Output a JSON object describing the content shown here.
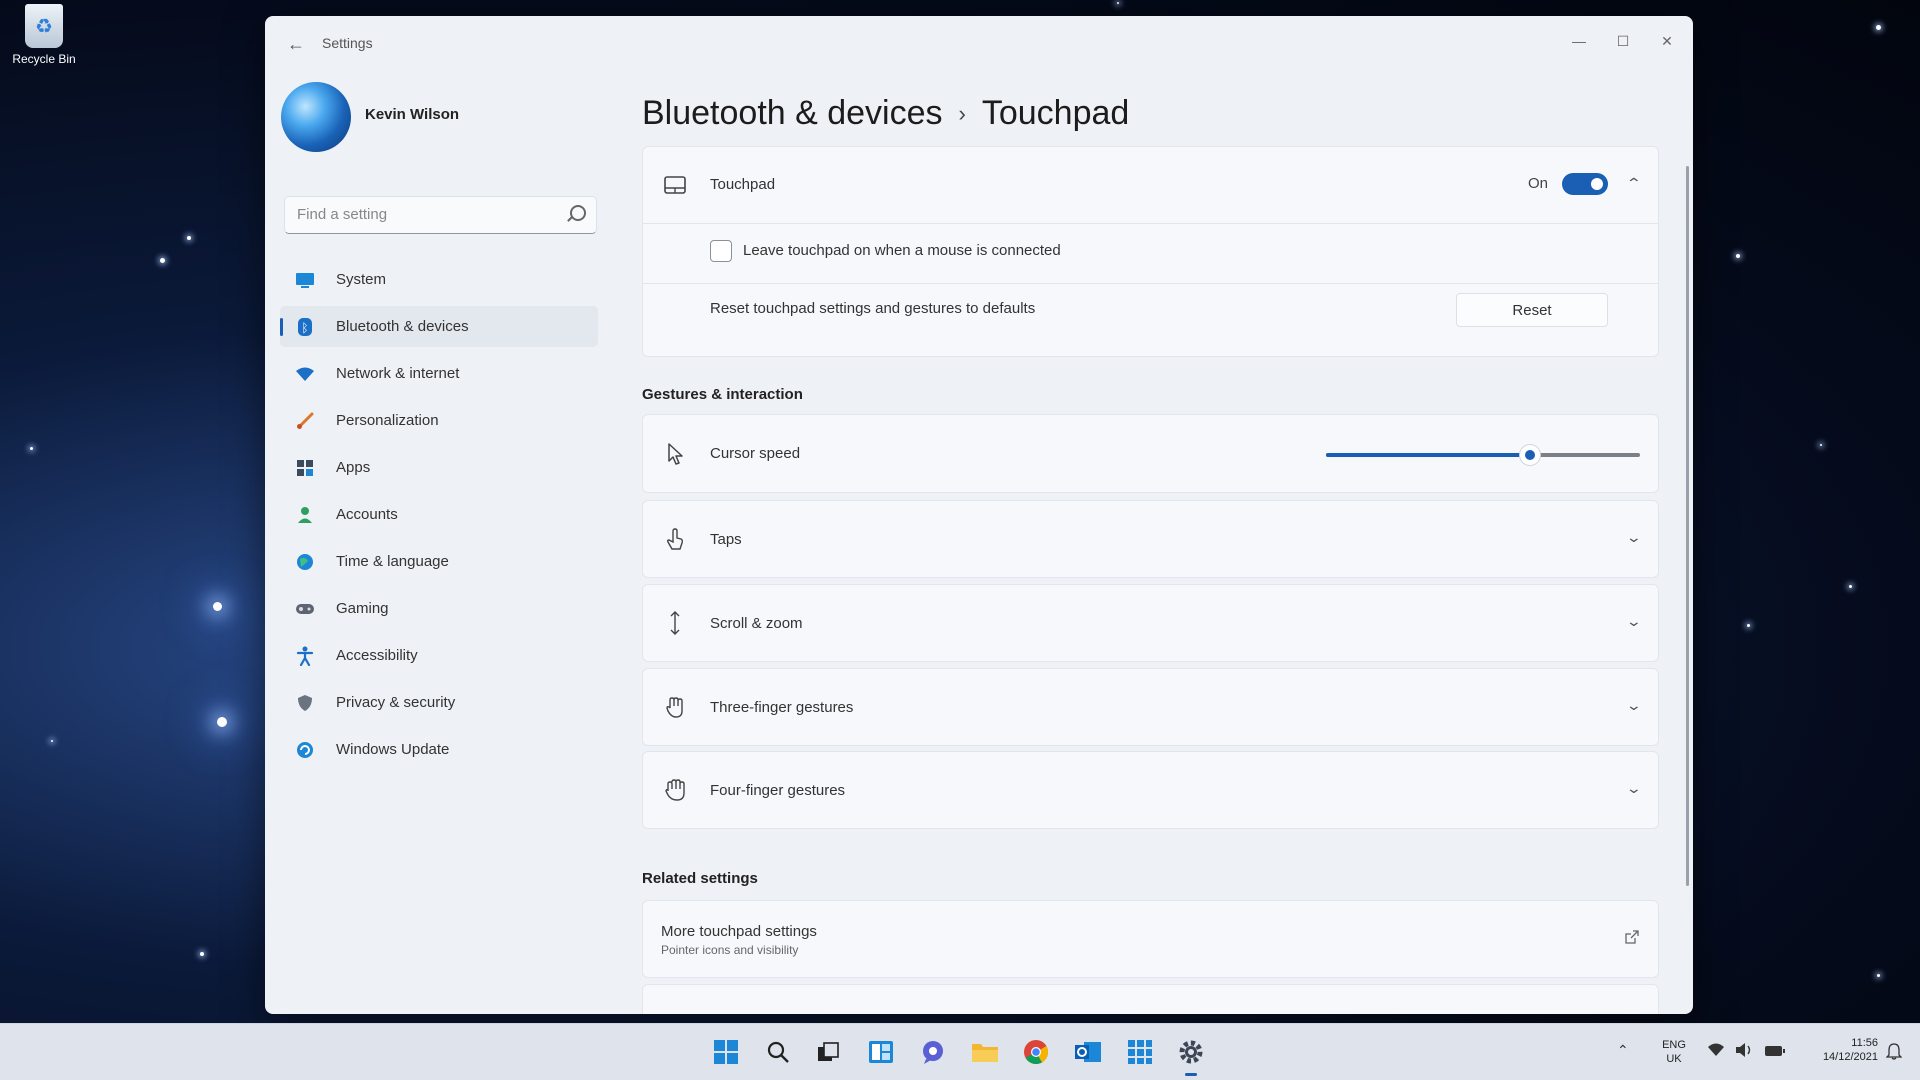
{
  "desktop": {
    "recycle_bin_label": "Recycle Bin"
  },
  "window": {
    "app_title": "Settings",
    "controls": {
      "minimize": "—",
      "maximize": "☐",
      "close": "✕"
    }
  },
  "profile": {
    "name": "Kevin Wilson"
  },
  "search": {
    "placeholder": "Find a setting"
  },
  "sidebar": {
    "items": [
      {
        "label": "System",
        "icon": "monitor-icon"
      },
      {
        "label": "Bluetooth & devices",
        "icon": "bluetooth-icon",
        "active": true
      },
      {
        "label": "Network & internet",
        "icon": "wifi-icon"
      },
      {
        "label": "Personalization",
        "icon": "brush-icon"
      },
      {
        "label": "Apps",
        "icon": "apps-icon"
      },
      {
        "label": "Accounts",
        "icon": "person-icon"
      },
      {
        "label": "Time & language",
        "icon": "globe-clock-icon"
      },
      {
        "label": "Gaming",
        "icon": "gamepad-icon"
      },
      {
        "label": "Accessibility",
        "icon": "accessibility-icon"
      },
      {
        "label": "Privacy & security",
        "icon": "shield-icon"
      },
      {
        "label": "Windows Update",
        "icon": "update-icon"
      }
    ]
  },
  "page": {
    "breadcrumb_parent": "Bluetooth & devices",
    "breadcrumb_separator": "›",
    "title": "Touchpad"
  },
  "touchpad": {
    "label": "Touchpad",
    "state_label": "On",
    "enabled": true,
    "leave_on_label": "Leave touchpad on when a mouse is connected",
    "leave_on_checked": false,
    "reset_label": "Reset touchpad settings and gestures to defaults",
    "reset_button": "Reset"
  },
  "gestures": {
    "section_title": "Gestures & interaction",
    "cursor_speed": {
      "label": "Cursor speed",
      "value_fraction": 0.65
    },
    "items": [
      {
        "label": "Taps",
        "icon": "tap-icon"
      },
      {
        "label": "Scroll & zoom",
        "icon": "scroll-icon"
      },
      {
        "label": "Three-finger gestures",
        "icon": "three-finger-icon"
      },
      {
        "label": "Four-finger gestures",
        "icon": "four-finger-icon"
      }
    ]
  },
  "related": {
    "section_title": "Related settings",
    "items": [
      {
        "title": "More touchpad settings",
        "subtitle": "Pointer icons and visibility"
      }
    ]
  },
  "taskbar": {
    "tray": {
      "lang_top": "ENG",
      "lang_bottom": "UK",
      "time": "11:56",
      "date": "14/12/2021"
    }
  },
  "colors": {
    "accent": "#1a5fb4",
    "window_bg": "#eef1f6"
  }
}
